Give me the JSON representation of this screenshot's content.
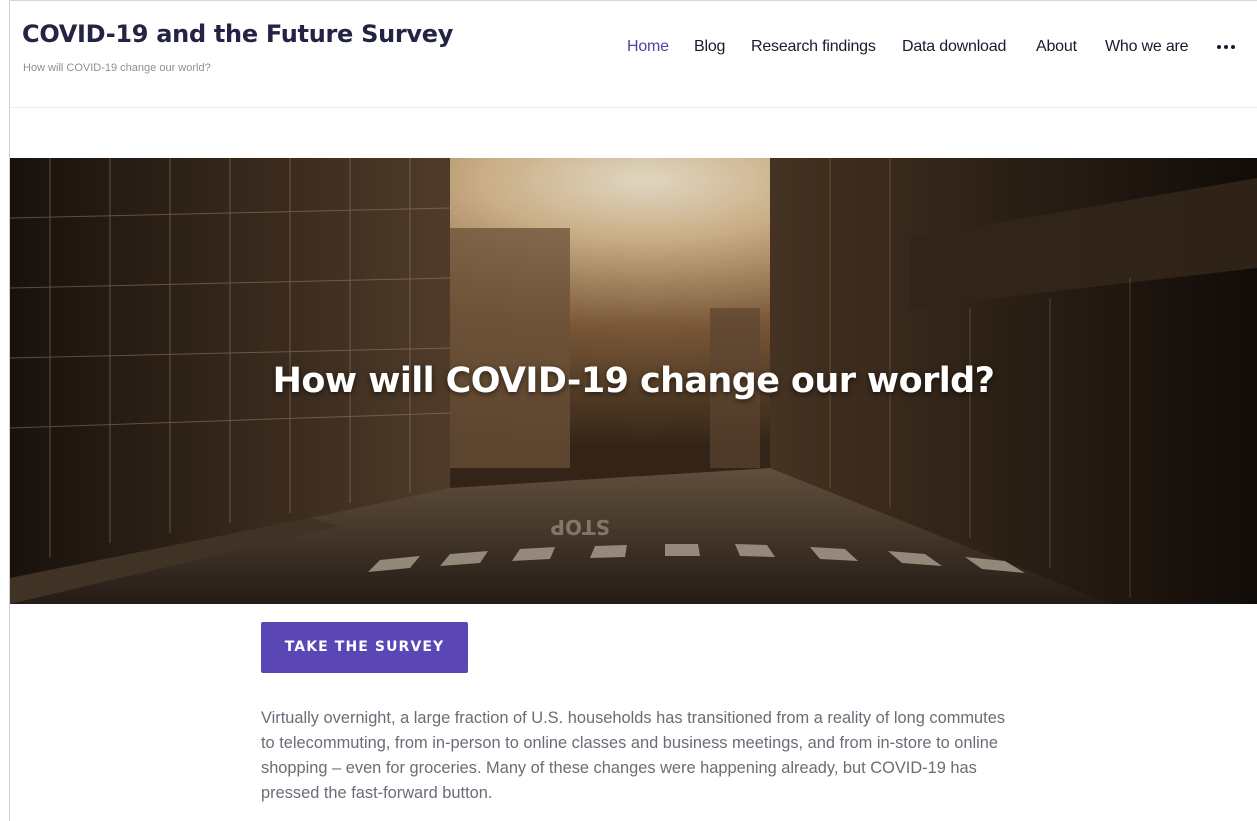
{
  "header": {
    "site_title": "COVID-19 and the Future Survey",
    "tagline": "How will COVID-19 change our world?"
  },
  "nav": {
    "items": [
      {
        "label": "Home",
        "active": true
      },
      {
        "label": "Blog",
        "active": false
      },
      {
        "label": "Research findings",
        "active": false
      },
      {
        "label": "Data download",
        "active": false
      },
      {
        "label": "About",
        "active": false
      },
      {
        "label": "Who we are",
        "active": false
      }
    ],
    "more_icon": "more-horizontal-icon"
  },
  "hero": {
    "heading": "How will COVID-19 change our world?",
    "image_description_icon": "empty-city-street-image",
    "road_marking": "STOP"
  },
  "cta": {
    "label": "TAKE THE SURVEY"
  },
  "intro": {
    "text": "Virtually overnight, a large fraction of U.S. households has transitioned from a reality of long commutes to telecommuting, from in-person to online classes and business meetings, and from in-store to online shopping – even for groceries. Many of these changes were happening already, but COVID-19 has pressed the fast-forward button."
  },
  "colors": {
    "accent": "#5a47b5",
    "nav_active": "#4e44a8",
    "title": "#232343",
    "body_text": "#6c6c78"
  }
}
